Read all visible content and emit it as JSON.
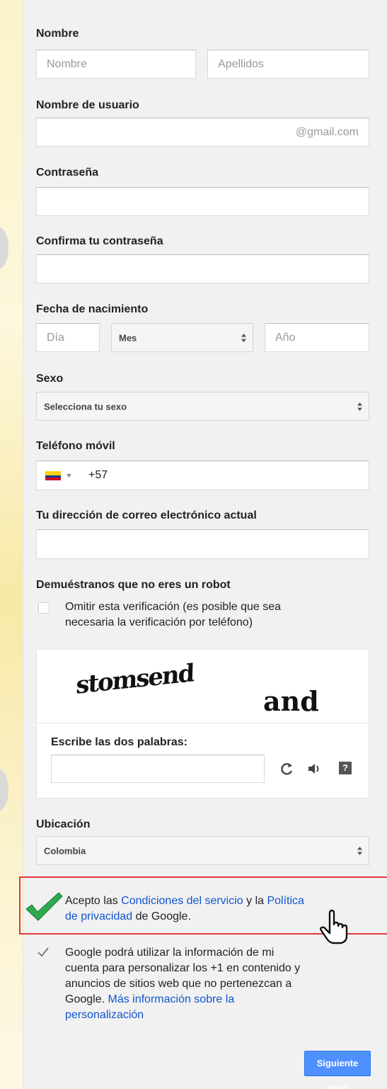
{
  "name": {
    "label": "Nombre",
    "first_placeholder": "Nombre",
    "last_placeholder": "Apellidos"
  },
  "username": {
    "label": "Nombre de usuario",
    "suffix": "@gmail.com"
  },
  "password": {
    "label": "Contraseña"
  },
  "confirm_password": {
    "label": "Confirma tu contraseña"
  },
  "birthdate": {
    "label": "Fecha de nacimiento",
    "day_placeholder": "Día",
    "month_value": "Mes",
    "year_placeholder": "Año"
  },
  "gender": {
    "label": "Sexo",
    "value": "Selecciona tu sexo"
  },
  "phone": {
    "label": "Teléfono móvil",
    "country_code": "+57",
    "flag_icon": "colombia-flag-icon"
  },
  "current_email": {
    "label": "Tu dirección de correo electrónico actual"
  },
  "robot": {
    "title": "Demuéstranos que no eres un robot",
    "skip_line1": "Omitir esta verificación (es posible que sea",
    "skip_line2": "necesaria la verificación por teléfono)",
    "captcha_word1": "stomsend",
    "captcha_word2": "and",
    "instruction": "Escribe las dos palabras:",
    "icons": [
      "refresh-icon",
      "audio-icon",
      "help-icon"
    ]
  },
  "location": {
    "label": "Ubicación",
    "value": "Colombia"
  },
  "terms": {
    "text1": "Acepto las ",
    "link1": "Condiciones del servicio",
    "text2": " y la ",
    "link2a": "Política",
    "link2b": "de privacidad",
    "text3": " de Google.",
    "checked": true
  },
  "personalization": {
    "line1": "Google podrá utilizar la información de mi",
    "line2": "cuenta para personalizar los +1 en contenido y",
    "line3": "anuncios de sitios web que no pertenezcan a",
    "line4_text": "Google. ",
    "line4_link": "Más información sobre la",
    "line5_link": "personalización",
    "checked": true
  },
  "submit": {
    "label": "Siguiente paso",
    "color": "#4d90fe"
  },
  "colors": {
    "link": "#1155cc",
    "highlight_border": "#e4393a",
    "check_green": "#28a745"
  }
}
